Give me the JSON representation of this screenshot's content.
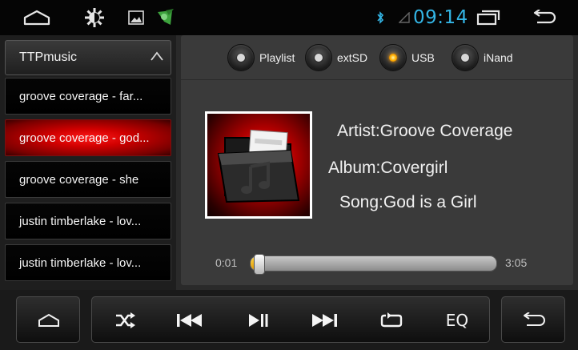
{
  "status_bar": {
    "time": "09:14",
    "icons": [
      "home-icon",
      "brightness-icon",
      "gallery-icon",
      "app-icon",
      "bluetooth-icon",
      "signal-icon",
      "recent-apps-icon",
      "back-icon"
    ]
  },
  "playlist": {
    "header": "TTPmusic",
    "items": [
      {
        "label": "groove coverage - far...",
        "active": false
      },
      {
        "label": "groove coverage - god...",
        "active": true
      },
      {
        "label": "groove coverage - she",
        "active": false
      },
      {
        "label": "justin timberlake - lov...",
        "active": false
      },
      {
        "label": "justin timberlake - lov...",
        "active": false
      }
    ]
  },
  "sources": [
    {
      "label": "Playlist",
      "selected": false
    },
    {
      "label": "extSD",
      "selected": false
    },
    {
      "label": "USB",
      "selected": true
    },
    {
      "label": "iNand",
      "selected": false
    }
  ],
  "track": {
    "artist": "Artist:Groove Coverage",
    "album": "Album:Covergirl",
    "song": "Song:God is a Girl"
  },
  "progress": {
    "current": "0:01",
    "total": "3:05",
    "fraction": 0.005
  },
  "controls": {
    "eq_label": "EQ"
  },
  "colors": {
    "accent": "#33b5e5",
    "active_item": "#d10000",
    "selected_radio": "#ffb000",
    "seek_fill": "#e09500"
  }
}
